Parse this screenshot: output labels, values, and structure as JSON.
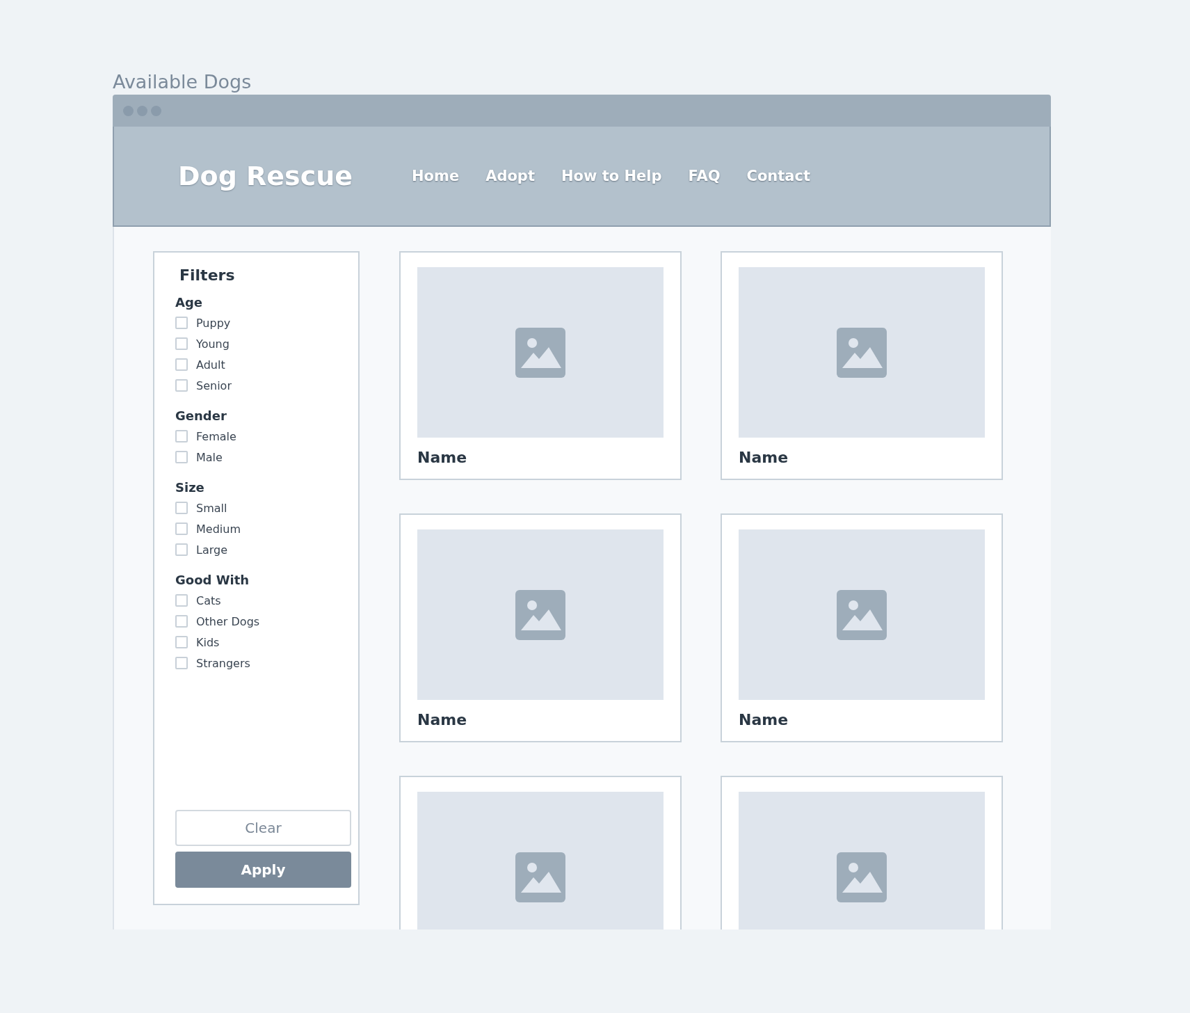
{
  "page_title": "Available Dogs",
  "site": {
    "logo": "Dog Rescue",
    "nav": [
      {
        "label": "Home"
      },
      {
        "label": "Adopt"
      },
      {
        "label": "How to Help"
      },
      {
        "label": "FAQ"
      },
      {
        "label": "Contact"
      }
    ]
  },
  "filters": {
    "title": "Filters",
    "groups": [
      {
        "heading": "Age",
        "options": [
          {
            "label": "Puppy",
            "checked": false
          },
          {
            "label": "Young",
            "checked": false
          },
          {
            "label": "Adult",
            "checked": false
          },
          {
            "label": "Senior",
            "checked": false
          }
        ]
      },
      {
        "heading": "Gender",
        "options": [
          {
            "label": "Female",
            "checked": false
          },
          {
            "label": "Male",
            "checked": false
          }
        ]
      },
      {
        "heading": "Size",
        "options": [
          {
            "label": "Small",
            "checked": false
          },
          {
            "label": "Medium",
            "checked": false
          },
          {
            "label": "Large",
            "checked": false
          }
        ]
      },
      {
        "heading": "Good With",
        "options": [
          {
            "label": "Cats",
            "checked": false
          },
          {
            "label": "Other Dogs",
            "checked": false
          },
          {
            "label": "Kids",
            "checked": false
          },
          {
            "label": "Strangers",
            "checked": false
          }
        ]
      }
    ],
    "buttons": [
      {
        "label": "Clear",
        "kind": "secondary"
      },
      {
        "label": "Apply",
        "kind": "primary"
      }
    ]
  },
  "cards": [
    {
      "kind": "named",
      "name": "Name"
    },
    {
      "kind": "named",
      "name": "Name"
    },
    {
      "kind": "named",
      "name": "Name"
    },
    {
      "kind": "named",
      "name": "Name"
    },
    {
      "kind": "cut"
    },
    {
      "kind": "cut"
    }
  ]
}
